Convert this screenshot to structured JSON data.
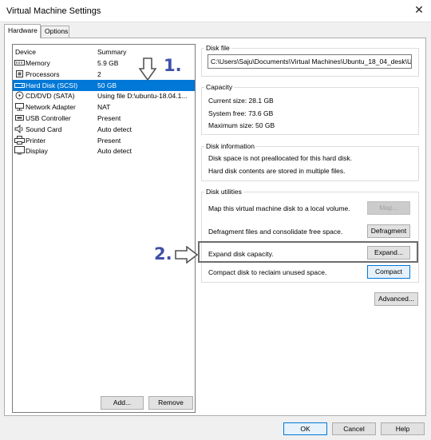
{
  "window": {
    "title": "Virtual Machine Settings"
  },
  "tabs": [
    {
      "label": "Hardware",
      "active": true
    },
    {
      "label": "Options",
      "active": false
    }
  ],
  "devices": {
    "headers": {
      "device": "Device",
      "summary": "Summary"
    },
    "rows": [
      {
        "name": "Memory",
        "summary": "5.9 GB",
        "icon": "memory-icon",
        "selected": false
      },
      {
        "name": "Processors",
        "summary": "2",
        "icon": "processor-icon",
        "selected": false
      },
      {
        "name": "Hard Disk (SCSI)",
        "summary": "50 GB",
        "icon": "hard-disk-icon",
        "selected": true
      },
      {
        "name": "CD/DVD (SATA)",
        "summary": "Using file D:\\ubuntu-18.04.1...",
        "icon": "cd-dvd-icon",
        "selected": false
      },
      {
        "name": "Network Adapter",
        "summary": "NAT",
        "icon": "network-adapter-icon",
        "selected": false
      },
      {
        "name": "USB Controller",
        "summary": "Present",
        "icon": "usb-controller-icon",
        "selected": false
      },
      {
        "name": "Sound Card",
        "summary": "Auto detect",
        "icon": "sound-card-icon",
        "selected": false
      },
      {
        "name": "Printer",
        "summary": "Present",
        "icon": "printer-icon",
        "selected": false
      },
      {
        "name": "Display",
        "summary": "Auto detect",
        "icon": "display-icon",
        "selected": false
      }
    ],
    "add_label": "Add...",
    "remove_label": "Remove"
  },
  "disk_file": {
    "label": "Disk file",
    "path": "C:\\Users\\Saju\\Documents\\Virtual Machines\\Ubuntu_18_04_desk\\U"
  },
  "capacity": {
    "label": "Capacity",
    "current_size": "Current size: 28.1 GB",
    "system_free": "System free: 73.6 GB",
    "maximum_size": "Maximum size: 50 GB"
  },
  "disk_information": {
    "label": "Disk information",
    "line1": "Disk space is not preallocated for this hard disk.",
    "line2": "Hard disk contents are stored in multiple files."
  },
  "disk_utilities": {
    "label": "Disk utilities",
    "map_text": "Map this virtual machine disk to a local volume.",
    "map_button": "Map...",
    "defrag_text": "Defragment files and consolidate free space.",
    "defrag_button": "Defragment",
    "expand_text": "Expand disk capacity.",
    "expand_button": "Expand...",
    "compact_text": "Compact disk to reclaim unused space.",
    "compact_button": "Compact"
  },
  "advanced_button": "Advanced...",
  "footer": {
    "ok": "OK",
    "cancel": "Cancel",
    "help": "Help"
  },
  "annotations": {
    "step1": "1.",
    "step2": "2."
  },
  "colors": {
    "selection": "#0078d7",
    "annotation": "#3f4fa8"
  }
}
